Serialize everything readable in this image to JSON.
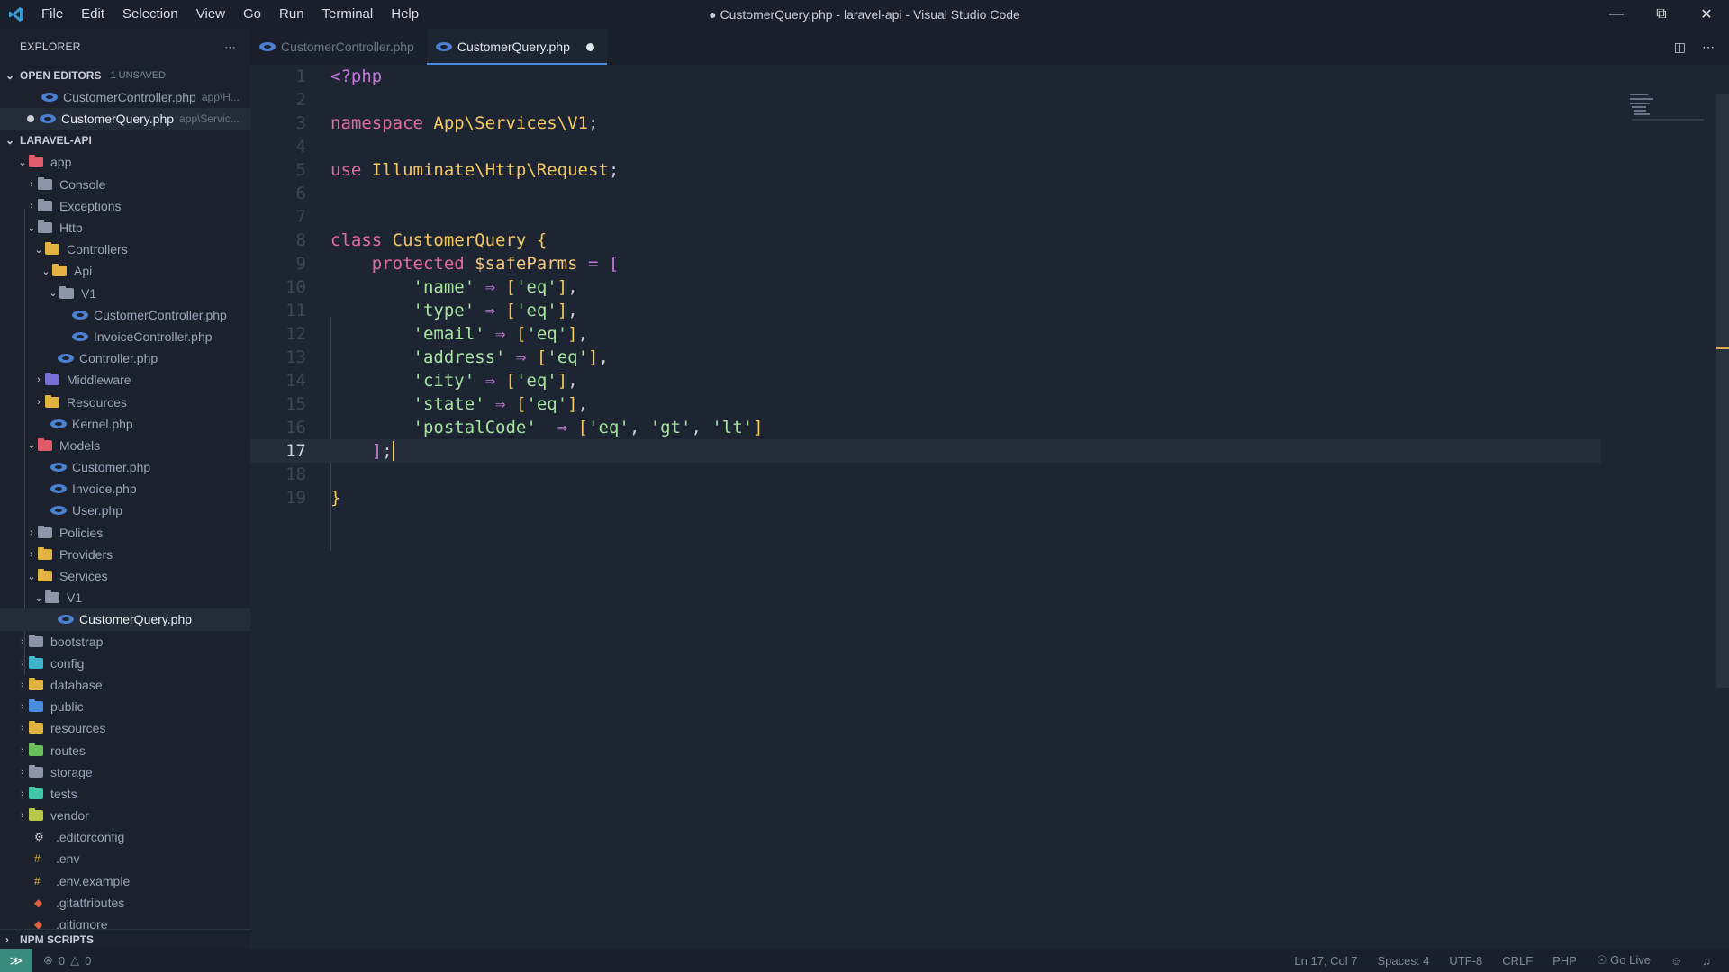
{
  "window": {
    "title": "● CustomerQuery.php - laravel-api - Visual Studio Code",
    "menu": [
      "File",
      "Edit",
      "Selection",
      "View",
      "Go",
      "Run",
      "Terminal",
      "Help"
    ]
  },
  "sidebar": {
    "header": "EXPLORER",
    "more": "···",
    "open_editors": {
      "title": "OPEN EDITORS",
      "badge": "1 UNSAVED",
      "items": [
        {
          "name": "CustomerController.php",
          "desc": "app\\H..."
        },
        {
          "name": "CustomerQuery.php",
          "desc": "app\\Servic..."
        }
      ]
    },
    "project": "LARAVEL-API",
    "tree": [
      {
        "label": "app"
      },
      {
        "label": "Console"
      },
      {
        "label": "Exceptions"
      },
      {
        "label": "Http"
      },
      {
        "label": "Controllers"
      },
      {
        "label": "Api"
      },
      {
        "label": "V1"
      },
      {
        "label": "CustomerController.php"
      },
      {
        "label": "InvoiceController.php"
      },
      {
        "label": "Controller.php"
      },
      {
        "label": "Middleware"
      },
      {
        "label": "Resources"
      },
      {
        "label": "Kernel.php"
      },
      {
        "label": "Models"
      },
      {
        "label": "Customer.php"
      },
      {
        "label": "Invoice.php"
      },
      {
        "label": "User.php"
      },
      {
        "label": "Policies"
      },
      {
        "label": "Providers"
      },
      {
        "label": "Services"
      },
      {
        "label": "V1"
      },
      {
        "label": "CustomerQuery.php"
      },
      {
        "label": "bootstrap"
      },
      {
        "label": "config"
      },
      {
        "label": "database"
      },
      {
        "label": "public"
      },
      {
        "label": "resources"
      },
      {
        "label": "routes"
      },
      {
        "label": "storage"
      },
      {
        "label": "tests"
      },
      {
        "label": "vendor"
      },
      {
        "label": ".editorconfig"
      },
      {
        "label": ".env"
      },
      {
        "label": ".env.example"
      },
      {
        "label": ".gitattributes"
      },
      {
        "label": ".gitignore"
      }
    ],
    "npm": "NPM SCRIPTS"
  },
  "tabs": [
    {
      "label": "CustomerController.php"
    },
    {
      "label": "CustomerQuery.php"
    }
  ],
  "code": {
    "line_numbers": [
      "1",
      "2",
      "3",
      "4",
      "5",
      "6",
      "7",
      "8",
      "9",
      "10",
      "11",
      "12",
      "13",
      "14",
      "15",
      "16",
      "17",
      "18",
      "19"
    ],
    "lines": {
      "l1": "<?php",
      "l3_kw": "namespace",
      "l3_ns": "App\\Services\\V1",
      "l5_kw": "use",
      "l5_ns": "Illuminate\\Http\\Request",
      "l8_kw": "class",
      "l8_name": "CustomerQuery",
      "l9_kw": "protected",
      "l9_var": "$safeParms",
      "k_name": "'name'",
      "k_type": "'type'",
      "k_email": "'email'",
      "k_address": "'address'",
      "k_city": "'city'",
      "k_state": "'state'",
      "k_postal": "'postalCode'",
      "v_eq": "'eq'",
      "v_gt": "'gt'",
      "v_lt": "'lt'",
      "arrow": "⇒"
    }
  },
  "status": {
    "errors": "0",
    "warnings": "0",
    "position": "Ln 17, Col 7",
    "spaces": "Spaces: 4",
    "encoding": "UTF-8",
    "eol": "CRLF",
    "language": "PHP",
    "golive": "Go Live"
  },
  "colors": {
    "accent": "#4b8be0",
    "keyword": "#e06c9f",
    "class": "#f3c85d",
    "string": "#a6e3a1"
  }
}
